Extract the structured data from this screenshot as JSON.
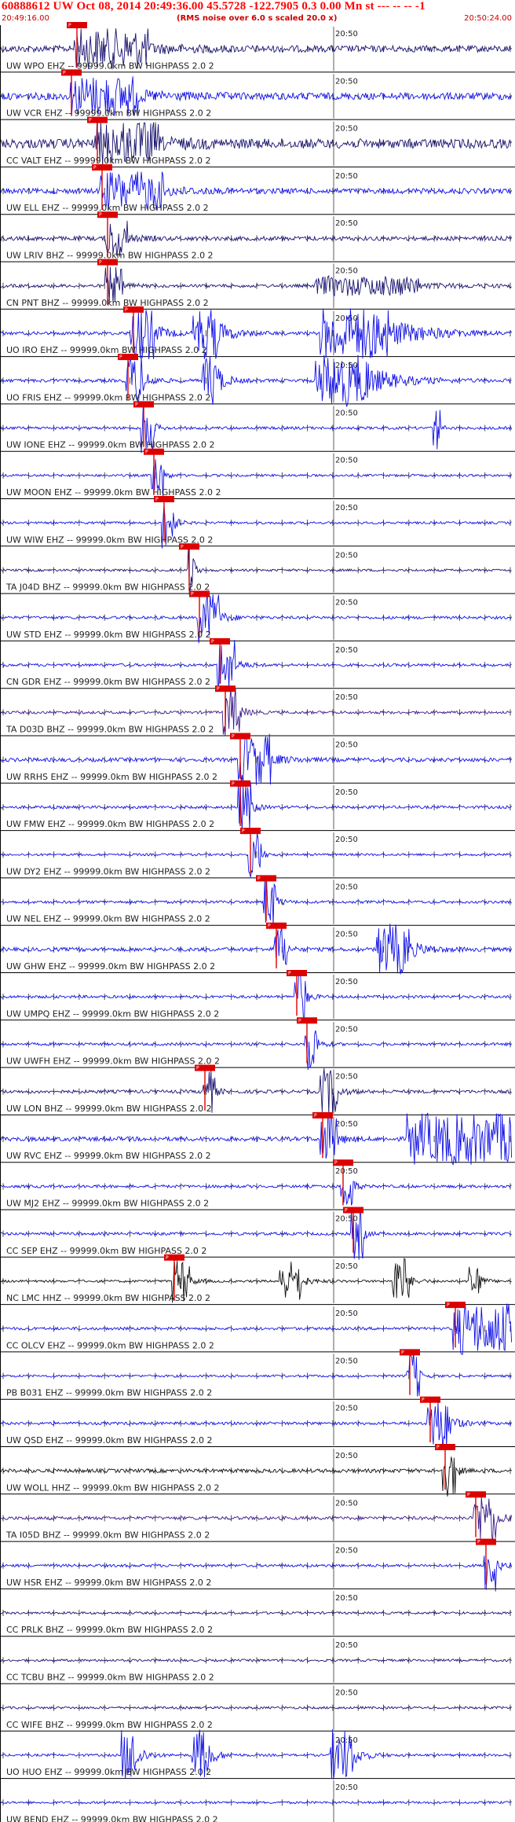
{
  "header": {
    "title": "60888612 UW Oct 08, 2014 20:49:36.00  45.5728 -122.7905  0.3 0.00 Mn st --- -- -- -1",
    "start_time": "20:49:16.00",
    "subtitle": "(RMS noise over 6.0 s scaled 20.0 x)",
    "end_time": "20:50:24.00"
  },
  "chart_data": {
    "type": "line",
    "x_range": [
      "20:49:16.00",
      "20:50:24.00"
    ],
    "minute_mark": "20:50",
    "filter_label": " -- 99999.0km BW  HIGHPASS  2.0  2",
    "colors": {
      "blue": "#1010e8",
      "navy": "#1a1470",
      "purple": "#3a1a8a",
      "black": "#111111",
      "pick": "#dd0000",
      "grid": "#222222"
    },
    "stations": [
      {
        "name": "UW WPO EHZ",
        "color": "navy",
        "amp": 0.7,
        "pick": "P",
        "bursts": [
          {
            "t": 0.15,
            "w": 0.14,
            "a": 1.0
          }
        ]
      },
      {
        "name": "UW VCR EHZ",
        "color": "blue",
        "amp": 0.75,
        "pick": "P",
        "bursts": [
          {
            "t": 0.14,
            "w": 0.13,
            "a": 1.0
          }
        ]
      },
      {
        "name": "CC VALT EHZ",
        "color": "navy",
        "amp": 1.0,
        "pick": "P",
        "bursts": [
          {
            "t": 0.19,
            "w": 0.12,
            "a": 1.0
          }
        ]
      },
      {
        "name": "UW ELL EHZ",
        "color": "blue",
        "amp": 0.55,
        "pick": "P",
        "bursts": [
          {
            "t": 0.2,
            "w": 0.12,
            "a": 1.0
          }
        ]
      },
      {
        "name": "UW LRIV BHZ",
        "color": "navy",
        "amp": 0.45,
        "pick": "P",
        "bursts": [
          {
            "t": 0.21,
            "w": 0.04,
            "a": 1.0
          }
        ]
      },
      {
        "name": "CN PNT BHZ",
        "color": "navy",
        "amp": 0.35,
        "pick": "P",
        "bursts": [
          {
            "t": 0.21,
            "w": 0.03,
            "a": 1.0
          },
          {
            "t": 0.62,
            "w": 0.2,
            "a": 0.5
          }
        ]
      },
      {
        "name": "UO IRO EHZ",
        "color": "blue",
        "amp": 0.35,
        "pick": "P",
        "bursts": [
          {
            "t": 0.26,
            "w": 0.04,
            "a": 3.0
          },
          {
            "t": 0.38,
            "w": 0.05,
            "a": 3.0
          },
          {
            "t": 0.63,
            "w": 0.13,
            "a": 4.0
          }
        ]
      },
      {
        "name": "UO FRIS EHZ",
        "color": "blue",
        "amp": 0.35,
        "pick": "P",
        "bursts": [
          {
            "t": 0.25,
            "w": 0.03,
            "a": 3.0
          },
          {
            "t": 0.4,
            "w": 0.03,
            "a": 3.0
          },
          {
            "t": 0.62,
            "w": 0.1,
            "a": 4.0
          }
        ]
      },
      {
        "name": "UW IONE EHZ",
        "color": "blue",
        "amp": 0.3,
        "pick": "P",
        "bursts": [
          {
            "t": 0.28,
            "w": 0.02,
            "a": 1.5
          },
          {
            "t": 0.85,
            "w": 0.01,
            "a": 1.2
          }
        ]
      },
      {
        "name": "UW MOON EHZ",
        "color": "blue",
        "amp": 0.25,
        "pick": "P",
        "bursts": [
          {
            "t": 0.3,
            "w": 0.02,
            "a": 1.5
          }
        ]
      },
      {
        "name": "UW WIW EHZ",
        "color": "blue",
        "amp": 0.25,
        "pick": "P",
        "bursts": [
          {
            "t": 0.32,
            "w": 0.02,
            "a": 2.0
          }
        ]
      },
      {
        "name": "TA J04D BHZ",
        "color": "navy",
        "amp": 0.25,
        "pick": "P",
        "bursts": [
          {
            "t": 0.37,
            "w": 0.01,
            "a": 2.5
          }
        ]
      },
      {
        "name": "UW STD EHZ",
        "color": "blue",
        "amp": 0.3,
        "pick": "P",
        "bursts": [
          {
            "t": 0.39,
            "w": 0.04,
            "a": 1.5
          }
        ]
      },
      {
        "name": "CN GDR EHZ",
        "color": "blue",
        "amp": 0.3,
        "pick": "P",
        "bursts": [
          {
            "t": 0.43,
            "w": 0.03,
            "a": 1.8
          }
        ]
      },
      {
        "name": "TA D03D BHZ",
        "color": "purple",
        "amp": 0.3,
        "pick": "P",
        "bursts": [
          {
            "t": 0.44,
            "w": 0.03,
            "a": 1.5
          }
        ]
      },
      {
        "name": "UW RRHS EHZ",
        "color": "blue",
        "amp": 0.4,
        "pick": "P",
        "bursts": [
          {
            "t": 0.47,
            "w": 0.06,
            "a": 1.5
          }
        ]
      },
      {
        "name": "UW FMW EHZ",
        "color": "blue",
        "amp": 0.3,
        "pick": "P",
        "bursts": [
          {
            "t": 0.47,
            "w": 0.02,
            "a": 2.5
          }
        ]
      },
      {
        "name": "UW DY2 EHZ",
        "color": "blue",
        "amp": 0.25,
        "pick": "P",
        "bursts": [
          {
            "t": 0.49,
            "w": 0.02,
            "a": 1.3
          }
        ]
      },
      {
        "name": "UW NEL EHZ",
        "color": "blue",
        "amp": 0.3,
        "pick": "P",
        "bursts": [
          {
            "t": 0.52,
            "w": 0.02,
            "a": 1.5
          }
        ]
      },
      {
        "name": "UW GHW EHZ",
        "color": "blue",
        "amp": 0.4,
        "pick": "P",
        "bursts": [
          {
            "t": 0.54,
            "w": 0.02,
            "a": 1.2
          },
          {
            "t": 0.74,
            "w": 0.06,
            "a": 2.2
          }
        ]
      },
      {
        "name": "UW UMPQ EHZ",
        "color": "blue",
        "amp": 0.3,
        "pick": "P",
        "bursts": [
          {
            "t": 0.58,
            "w": 0.02,
            "a": 1.6
          }
        ]
      },
      {
        "name": "UW UWFH EHZ",
        "color": "blue",
        "amp": 0.3,
        "pick": "P",
        "bursts": [
          {
            "t": 0.6,
            "w": 0.02,
            "a": 1.8
          }
        ]
      },
      {
        "name": "UW LON BHZ",
        "color": "navy",
        "amp": 0.35,
        "pick": "P",
        "bursts": [
          {
            "t": 0.4,
            "w": 0.02,
            "a": 1.2
          },
          {
            "t": 0.63,
            "w": 0.03,
            "a": 1.3
          }
        ]
      },
      {
        "name": "UW RVC EHZ",
        "color": "blue",
        "amp": 0.45,
        "pick": "P",
        "bursts": [
          {
            "t": 0.63,
            "w": 0.03,
            "a": 1.5
          },
          {
            "t": 0.8,
            "w": 0.32,
            "a": 2.5
          }
        ]
      },
      {
        "name": "UW MJ2 EHZ",
        "color": "blue",
        "amp": 0.3,
        "pick": "P",
        "bursts": [
          {
            "t": 0.67,
            "w": 0.02,
            "a": 1.6
          }
        ]
      },
      {
        "name": "CC SEP EHZ",
        "color": "blue",
        "amp": 0.3,
        "pick": "P",
        "bursts": [
          {
            "t": 0.69,
            "w": 0.02,
            "a": 1.5
          }
        ]
      },
      {
        "name": "NC LMC HHZ",
        "color": "black",
        "amp": 0.25,
        "pick": "P",
        "bursts": [
          {
            "t": 0.34,
            "w": 0.03,
            "a": 1.2
          },
          {
            "t": 0.55,
            "w": 0.04,
            "a": 1.1
          },
          {
            "t": 0.77,
            "w": 0.03,
            "a": 1.4
          },
          {
            "t": 0.92,
            "w": 0.02,
            "a": 1.2
          }
        ]
      },
      {
        "name": "CC OLCV EHZ",
        "color": "blue",
        "amp": 0.3,
        "pick": "P",
        "bursts": [
          {
            "t": 0.89,
            "w": 0.12,
            "a": 2.5
          }
        ]
      },
      {
        "name": "PB B031 EHZ",
        "color": "blue",
        "amp": 0.25,
        "pick": "P",
        "bursts": [
          {
            "t": 0.8,
            "w": 0.02,
            "a": 1.4
          }
        ]
      },
      {
        "name": "UW QSD EHZ",
        "color": "blue",
        "amp": 0.3,
        "pick": "P",
        "bursts": [
          {
            "t": 0.84,
            "w": 0.04,
            "a": 2.0
          }
        ]
      },
      {
        "name": "UW WOLL HHZ",
        "color": "black",
        "amp": 0.4,
        "pick": "P",
        "bursts": [
          {
            "t": 0.87,
            "w": 0.02,
            "a": 1.4
          }
        ]
      },
      {
        "name": "TA I05D BHZ",
        "color": "purple",
        "amp": 0.35,
        "pick": "P",
        "bursts": [
          {
            "t": 0.93,
            "w": 0.04,
            "a": 1.8
          }
        ]
      },
      {
        "name": "UW HSR EHZ",
        "color": "blue",
        "amp": 0.3,
        "pick": "P",
        "bursts": [
          {
            "t": 0.95,
            "w": 0.02,
            "a": 2.0
          }
        ]
      },
      {
        "name": "CC PRLK BHZ",
        "color": "navy",
        "amp": 0.25,
        "pick": "",
        "bursts": []
      },
      {
        "name": "CC TCBU BHZ",
        "color": "navy",
        "amp": 0.25,
        "pick": "",
        "bursts": []
      },
      {
        "name": "CC WIFE BHZ",
        "color": "navy",
        "amp": 0.25,
        "pick": "",
        "bursts": []
      },
      {
        "name": "UO HUO EHZ",
        "color": "blue",
        "amp": 0.25,
        "pick": "",
        "bursts": [
          {
            "t": 0.24,
            "w": 0.03,
            "a": 3.0
          },
          {
            "t": 0.38,
            "w": 0.03,
            "a": 3.0
          },
          {
            "t": 0.65,
            "w": 0.04,
            "a": 3.0
          }
        ]
      },
      {
        "name": "UW BEND EHZ",
        "color": "blue",
        "amp": 0.25,
        "pick": "",
        "bursts": []
      }
    ]
  }
}
